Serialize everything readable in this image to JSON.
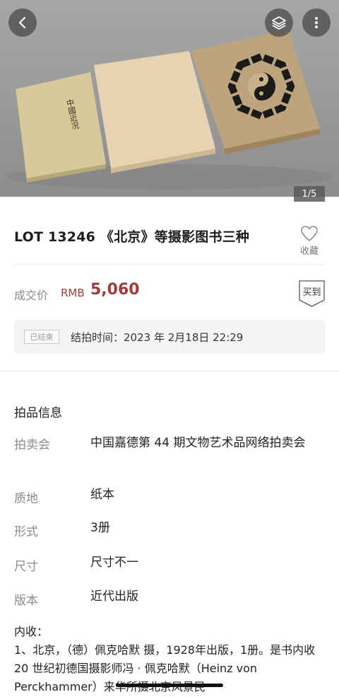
{
  "hero": {
    "counter": "1/5",
    "book_title_vertical": "中國近况",
    "icons": {
      "back": "chevron-left-icon",
      "layers": "layers-icon",
      "more": "more-vertical-icon"
    }
  },
  "lot": {
    "title": "LOT 13246 《北京》等摄影图书三种",
    "favorite_label": "收藏",
    "favorite_icon": "heart-outline-icon"
  },
  "price": {
    "label": "成交价",
    "currency": "RMB",
    "value": "5,060",
    "buy_tag": "买到",
    "accent_color": "#a33a3a"
  },
  "auction_end": {
    "status": "已结束",
    "label": "结拍时间：",
    "datetime": "2023 年 2月18日 22:29"
  },
  "info": {
    "section_title": "拍品信息",
    "rows": [
      {
        "key": "拍卖会",
        "value": "中国嘉德第 44 期文物艺术品网络拍卖会"
      },
      {
        "key": "质地",
        "value": "纸本"
      },
      {
        "key": "形式",
        "value": "3册"
      },
      {
        "key": "尺寸",
        "value": "尺寸不一"
      },
      {
        "key": "版本",
        "value": "近代出版"
      }
    ]
  },
  "description": {
    "heading": "内收：",
    "body": "1、北京，（德）佩克哈默 摄，1928年出版，1册。是书内收 20 世纪初德国摄影师冯 · 佩克哈默（Heinz von Perckhammer）来华所摄北京风景民"
  }
}
